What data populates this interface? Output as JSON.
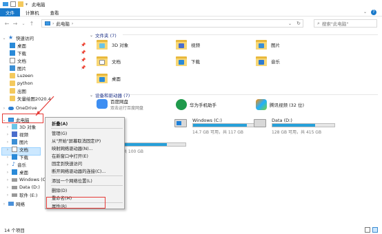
{
  "window": {
    "title": "此电脑"
  },
  "ribbon": {
    "tabs": [
      "文件",
      "计算机",
      "查看"
    ],
    "help": "?"
  },
  "address": {
    "path": "此电脑",
    "search_placeholder": "搜索\"此电脑\""
  },
  "sidebar": {
    "quick_access": "快速访问",
    "quick_items": [
      "桌面",
      "下载",
      "文档",
      "图片",
      "Luzeen",
      "python",
      "出图",
      "矢量绘图2020.4"
    ],
    "onedrive": "OneDrive",
    "this_pc": "此电脑",
    "pc_items": [
      "3D 对象",
      "视频",
      "图片",
      "文档",
      "下载",
      "音乐",
      "桌面",
      "Windows (C:)",
      "Data (D:)",
      "软件 (E:)"
    ],
    "network": "网络"
  },
  "content": {
    "folders_header": "文件夹 (7)",
    "folders": [
      {
        "name": "3D 对象",
        "icon": "3d-objects-icon"
      },
      {
        "name": "视频",
        "icon": "video-icon"
      },
      {
        "name": "图片",
        "icon": "picture-icon"
      },
      {
        "name": "文档",
        "icon": "document-icon"
      },
      {
        "name": "下载",
        "icon": "download-icon"
      },
      {
        "name": "音乐",
        "icon": "music-icon"
      },
      {
        "name": "桌面",
        "icon": "desktop-icon"
      }
    ],
    "devices_header": "设备和驱动器 (7)",
    "apps": [
      {
        "name": "百度网盘",
        "sub": "双击运行百度网盘"
      },
      {
        "name": "华为手机助手",
        "sub": ""
      },
      {
        "name": "腾讯视频 (32 位)",
        "sub": ""
      }
    ],
    "drives": [
      {
        "name": "Windows (C:)",
        "free": "14.7 GB 可用，共 117 GB",
        "used_fraction": 0.87,
        "color": "#26a0da"
      },
      {
        "name": "Data (D:)",
        "free": "128 GB 可用，共 415 GB",
        "used_fraction": 0.69,
        "color": "#26a0da"
      },
      {
        "name": "",
        "free": "共 100 GB",
        "used_fraction": 0.7,
        "color": "#26a0da"
      }
    ]
  },
  "context_menu": {
    "items": [
      "折叠(A)",
      "管理(G)",
      "从\"开始\"屏幕取消固定(P)",
      "映射网络驱动器(N)...",
      "在新窗口中打开(E)",
      "固定到快速访问",
      "断开网络驱动器的连接(C)...",
      "添加一个网络位置(L)",
      "删除(D)",
      "重命名(M)",
      "属性(R)"
    ]
  },
  "status": {
    "count": "14 个项目"
  },
  "colors": {
    "accent": "#1979ca",
    "annotation": "#e53935",
    "selection": "#cce8ff"
  }
}
